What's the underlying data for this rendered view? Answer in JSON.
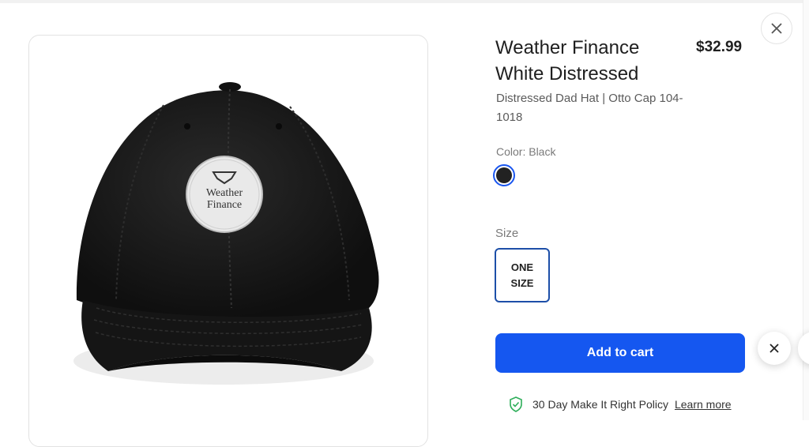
{
  "product": {
    "title": "Weather Finance White Distressed",
    "price": "$32.99",
    "subtitle": "Distressed Dad Hat | Otto Cap 104-1018",
    "color_label": "Color: Black",
    "color_value": "#222222",
    "size_label": "Size",
    "size_option": "ONE SIZE",
    "image_logo_text": [
      "Weather",
      "Finance"
    ]
  },
  "actions": {
    "add_to_cart": "Add to cart"
  },
  "policy": {
    "text": "30 Day Make It Right Policy",
    "link": "Learn more"
  },
  "icons": {
    "close": "close-icon",
    "shield": "shield-check-icon"
  },
  "colors": {
    "accent": "#1557f0",
    "selected_border": "#1d4fa8",
    "shield_green": "#2eae5a"
  }
}
